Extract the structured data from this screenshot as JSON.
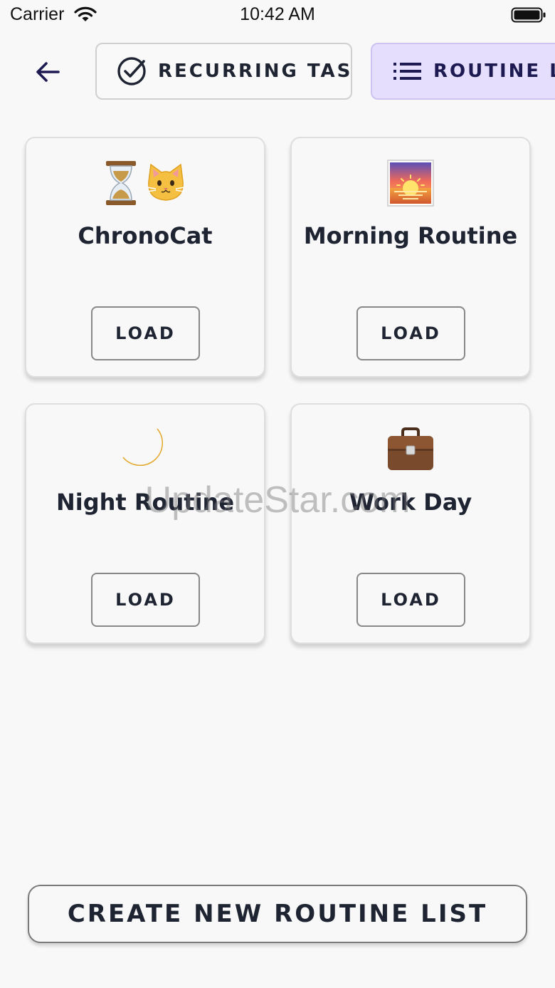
{
  "status_bar": {
    "carrier": "Carrier",
    "time": "10:42 AM",
    "icons": [
      "wifi-icon",
      "battery-icon"
    ]
  },
  "nav": {
    "back_icon": "arrow-left-icon",
    "tabs": [
      {
        "label": "RECURRING TASKS",
        "icon": "check-circle-icon",
        "selected": false
      },
      {
        "label": "ROUTINE LIST",
        "icon": "list-icon",
        "selected": true
      }
    ]
  },
  "routines": [
    {
      "emoji": "⏳🐱",
      "title": "ChronoCat",
      "button_label": "LOAD"
    },
    {
      "emoji": "🌅",
      "title": "Morning Routine",
      "button_label": "LOAD"
    },
    {
      "emoji": "🌙",
      "title": "Night Routine",
      "button_label": "LOAD"
    },
    {
      "emoji": "💼",
      "title": "Work Day",
      "button_label": "LOAD"
    }
  ],
  "watermark": "UpdateStar.com",
  "actions": {
    "create_label": "CREATE NEW ROUTINE LIST"
  },
  "colors": {
    "accent": "#1d1a52",
    "selected_tab_bg": "#e6defd",
    "text": "#1f2433",
    "background": "#f8f8f8"
  }
}
